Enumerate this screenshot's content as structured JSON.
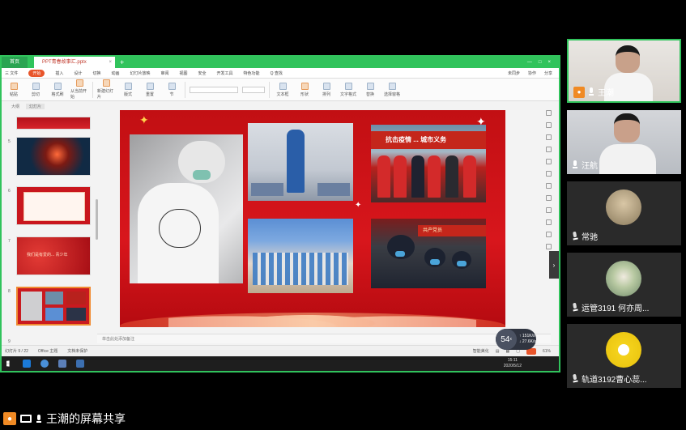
{
  "colors": {
    "accent": "#31c35c",
    "slide_red": "#c20f13",
    "avatar_orange": "#f08a24"
  },
  "shared_window": {
    "home_tab": "首页",
    "file_tab": "PPT青春故事汇.pptx",
    "menu": [
      "三 文件",
      "开始",
      "插入",
      "设计",
      "切换",
      "动画",
      "幻灯片放映",
      "审阅",
      "视图",
      "安全",
      "开发工具",
      "特色功能",
      "Q 查找"
    ],
    "menu_right": [
      "未同步",
      "协作",
      "分享"
    ],
    "ribbon": [
      "粘贴",
      "剪切",
      "格式刷",
      "从当前开始",
      "新建幻灯片",
      "版式",
      "重置",
      "节",
      "文本框",
      "形状",
      "排列",
      "文字格式",
      "替换",
      "选择窗格"
    ],
    "panel_tabs": [
      "大纲",
      "幻灯片"
    ],
    "thumbnail_numbers": [
      "5",
      "6",
      "7",
      "8",
      "9"
    ],
    "thumb_banner": "我们是有爱的... 青少年",
    "photo3_banner": "抗击疫情 ... 城市义务",
    "photo5_banner": "共产党员",
    "notes_placeholder": "单击此处添加备注",
    "status": [
      "幻灯片 9 / 22",
      "Office 主题",
      "文档未保护"
    ],
    "status_right": [
      "智能美化",
      "61%"
    ],
    "taskbar_time": "15:11",
    "taskbar_date": "2020/5/12",
    "speed_value": "54",
    "speed_unit": "x",
    "speed_up": "↑ 151K/s",
    "speed_down": "↓ 27.6K/s"
  },
  "participants": [
    {
      "name": "王潮",
      "host": true,
      "mic": "on",
      "type": "video"
    },
    {
      "name": "汪航",
      "host": false,
      "mic": "on",
      "type": "video"
    },
    {
      "name": "常驰",
      "host": false,
      "mic": "muted",
      "type": "avatar"
    },
    {
      "name": "运管3191 何亦周...",
      "host": false,
      "mic": "muted",
      "type": "avatar"
    },
    {
      "name": "轨道3192曹心蕊...",
      "host": false,
      "mic": "muted",
      "type": "avatar"
    }
  ],
  "share_banner": {
    "text": "王潮的屏幕共享"
  },
  "icons": [
    "person-icon",
    "mic-icon",
    "screen-share-icon",
    "windows-icon",
    "add-icon",
    "close-icon",
    "play-icon"
  ]
}
